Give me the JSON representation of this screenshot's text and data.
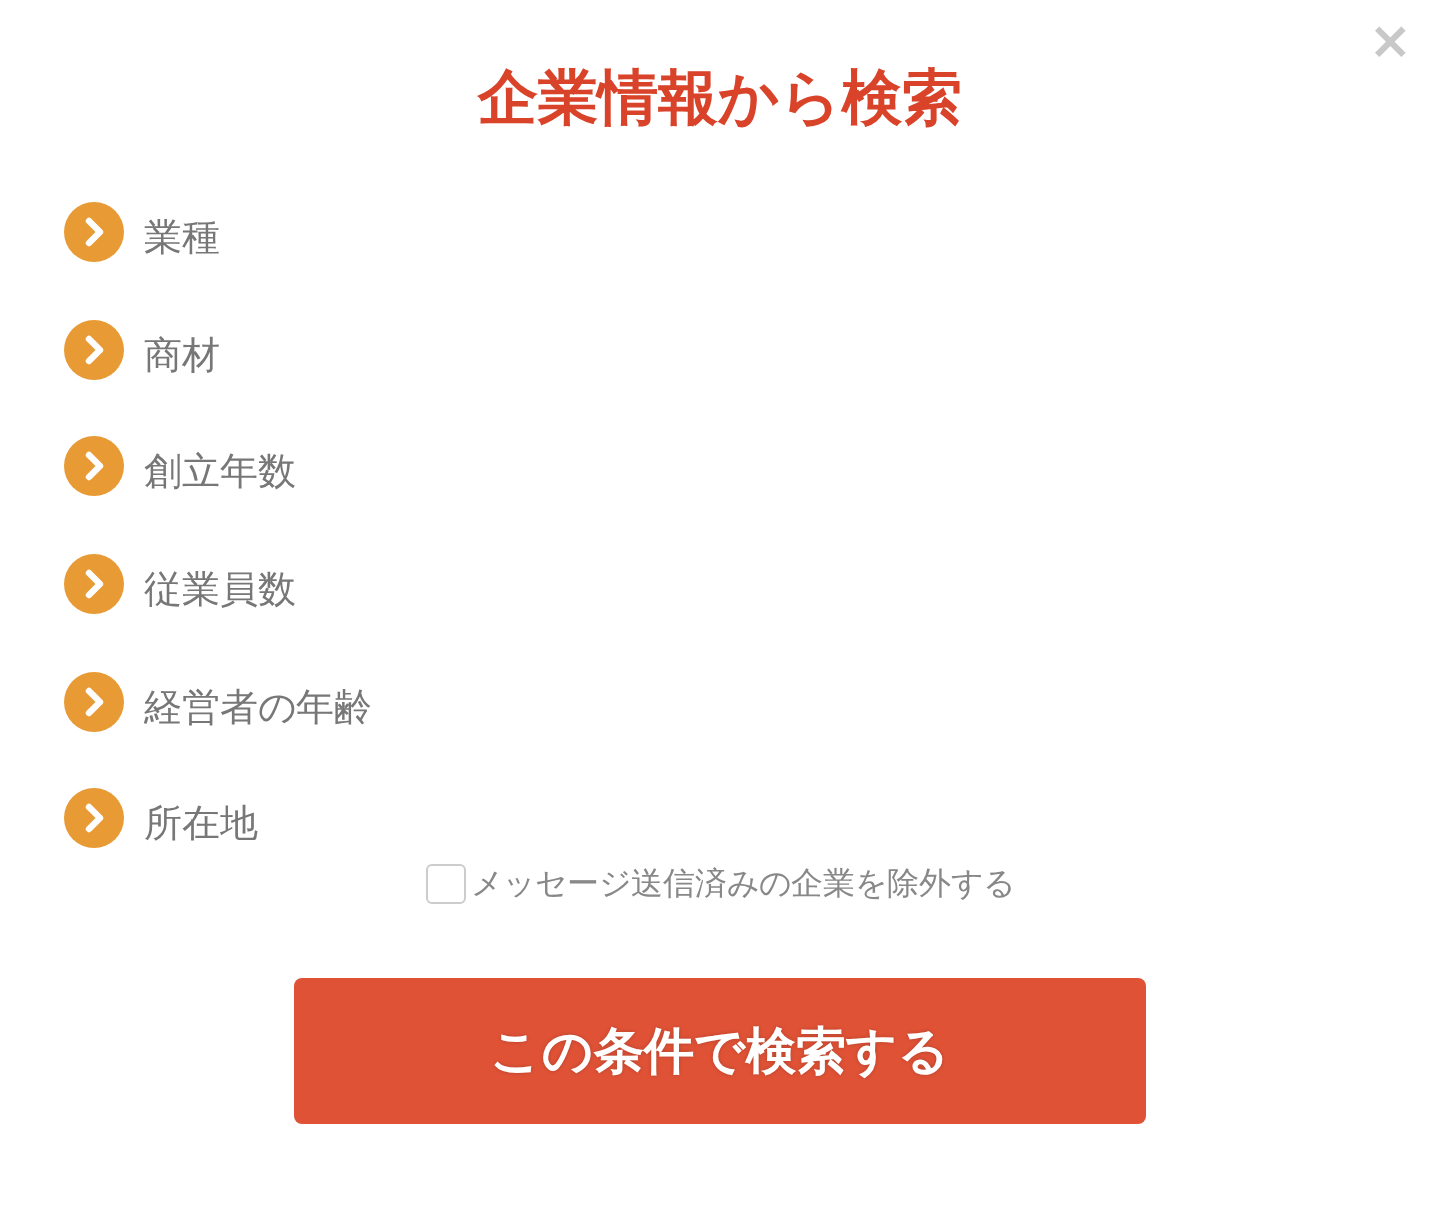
{
  "dialog": {
    "title": "企業情報から検索",
    "close": "×"
  },
  "categories": [
    {
      "label": "業種"
    },
    {
      "label": "商材"
    },
    {
      "label": "創立年数"
    },
    {
      "label": "従業員数"
    },
    {
      "label": "経営者の年齢"
    },
    {
      "label": "所在地"
    }
  ],
  "exclude_option": {
    "label": "メッセージ送信済みの企業を除外する",
    "checked": false
  },
  "search_button": "この条件で検索する"
}
